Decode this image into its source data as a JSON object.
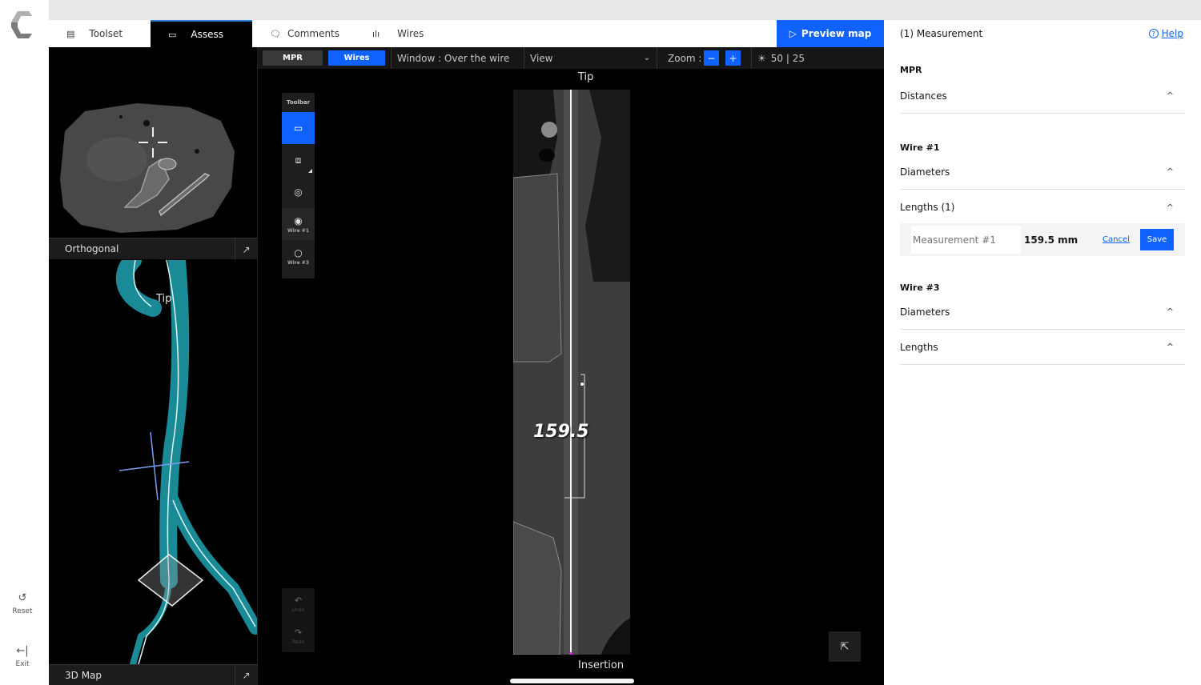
{
  "rail": {
    "logo": "app-logo",
    "reset_label": "Reset",
    "reset_icon": "↺",
    "exit_label": "Exit",
    "exit_icon": "←|"
  },
  "tabs": [
    {
      "label": "Toolset",
      "icon": "▤",
      "active": false
    },
    {
      "label": "Assess",
      "icon": "▭",
      "active": true
    },
    {
      "label": "Comments",
      "icon": "🗨",
      "active": false
    },
    {
      "label": "Wires",
      "icon": "ılı",
      "active": false
    }
  ],
  "preview_button": {
    "label": "Preview map",
    "icon": "▷"
  },
  "left_views": {
    "orthogonal_label": "Orthogonal",
    "map3d_label": "3D Map",
    "map3d_tip_label": "Tip",
    "expand_icon": "↗"
  },
  "center_toolbar": {
    "mpr_label": "MPR",
    "wires_label": "Wires",
    "window_text": "Window :  Over the wire",
    "view_select": "View",
    "view_chevron": "⌄",
    "zoom_label": "Zoom :",
    "zoom_minus": "−",
    "zoom_plus": "+",
    "brightness_icon": "☀",
    "window_level": "50 | 25"
  },
  "tool_palette": {
    "header": "Toolbar",
    "tools": [
      {
        "name": "ruler",
        "icon": "▭",
        "label": ""
      },
      {
        "name": "slab",
        "icon": "⧈",
        "label": ""
      },
      {
        "name": "focus",
        "icon": "◎",
        "label": ""
      },
      {
        "name": "wire-1",
        "icon": "◉",
        "label": "Wire #1"
      },
      {
        "name": "wire-3",
        "icon": "○",
        "label": "Wire #3"
      }
    ],
    "undo_label": "Undo",
    "undo_icon": "↶",
    "redo_label": "Redo",
    "redo_icon": "↷"
  },
  "curved_view": {
    "top_label": "Tip",
    "bottom_label": "Insertion",
    "measurement_value": "159.5",
    "cursor_icon": "⇱"
  },
  "right_panel": {
    "title": "(1) Measurement",
    "help_icon": "?",
    "help_label": "Help",
    "sections": [
      {
        "heading": "MPR",
        "items": [
          {
            "label": "Distances",
            "chevron": "^"
          }
        ]
      },
      {
        "heading": "Wire #1",
        "items": [
          {
            "label": "Diameters",
            "chevron": "^"
          },
          {
            "label": "Lengths (1)",
            "chevron": "^"
          }
        ]
      },
      {
        "heading": "Wire #3",
        "items": [
          {
            "label": "Diameters",
            "chevron": "^"
          },
          {
            "label": "Lengths",
            "chevron": "^"
          }
        ]
      }
    ],
    "measurement_row": {
      "placeholder": "Measurement #1",
      "value": "159.5 mm",
      "cancel_label": "Cancel",
      "save_label": "Save"
    }
  },
  "colors": {
    "accent": "#0f62fe",
    "vessel": "#1a9aa6",
    "wire": "#e8f7f9"
  }
}
